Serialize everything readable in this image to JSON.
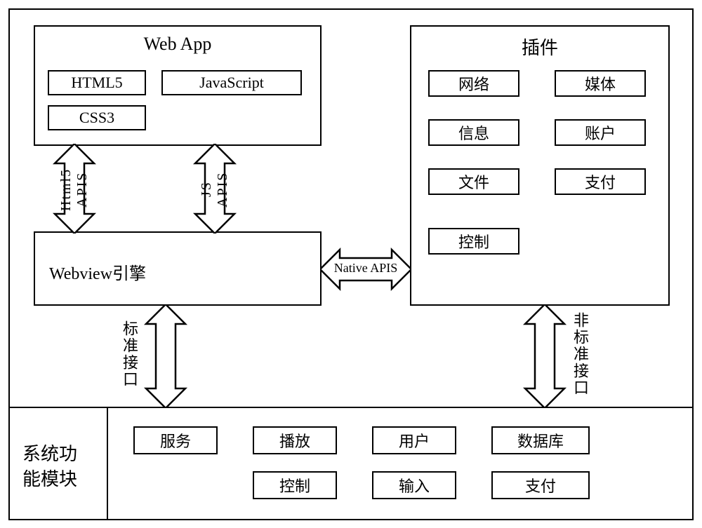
{
  "webapp": {
    "title": "Web App",
    "items": [
      "HTML5",
      "JavaScript",
      "CSS3"
    ]
  },
  "plugins": {
    "title": "插件",
    "items": [
      "网络",
      "媒体",
      "信息",
      "账户",
      "文件",
      "支付",
      "控制"
    ]
  },
  "webview": "Webview引擎",
  "connectors": {
    "html5_apis": "Html5 APIS",
    "js_apis": "JS APIS",
    "native_apis": "Native APIS",
    "std_iface": "标准接口",
    "nonstd_iface": "非标准接口"
  },
  "system": {
    "title_line1": "系统功",
    "title_line2": "能模块",
    "items": [
      "服务",
      "播放",
      "用户",
      "数据库",
      "控制",
      "输入",
      "支付"
    ]
  }
}
